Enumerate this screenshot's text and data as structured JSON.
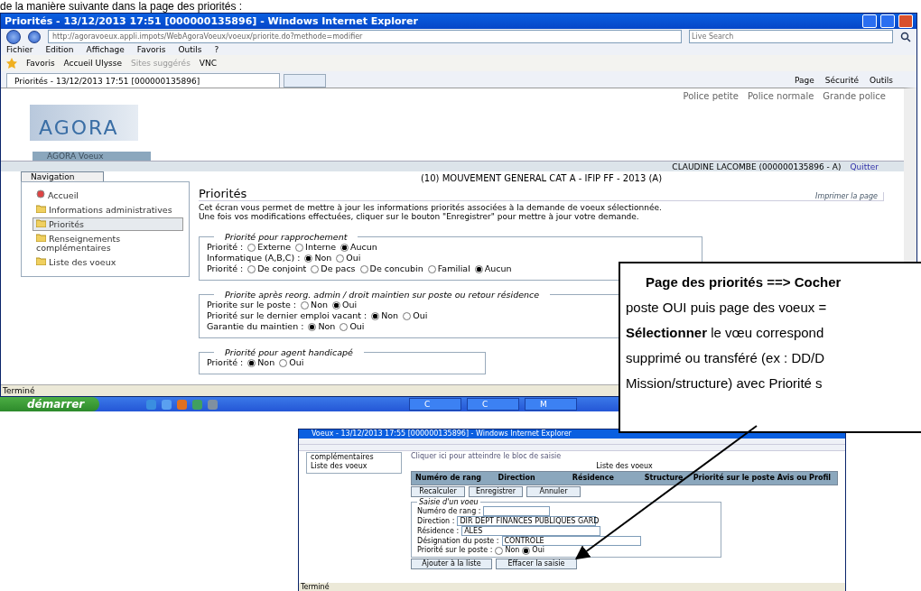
{
  "document_text": "de la manière suivante dans la page des priorités :",
  "browser": {
    "title": "Priorités - 13/12/2013 17:51 [000000135896] - Windows Internet Explorer",
    "address": "http://agoravoeux.appli.impots/WebAgoraVoeux/voeux/priorite.do?methode=modifier",
    "search_placeholder": "Live Search",
    "menu": [
      "Fichier",
      "Edition",
      "Affichage",
      "Favoris",
      "Outils",
      "?"
    ],
    "favorites": [
      {
        "label": "Favoris",
        "disabled": false
      },
      {
        "label": "Accueil Ulysse",
        "disabled": false
      },
      {
        "label": "Sites suggérés",
        "disabled": true
      },
      {
        "label": "VNC",
        "disabled": false
      }
    ],
    "tab": "Priorités - 13/12/2013 17:51 [000000135896]",
    "commands": [
      "Page",
      "Sécurité",
      "Outils"
    ],
    "status": "Terminé"
  },
  "page": {
    "font_links": [
      "Police petite",
      "Police normale",
      "Grande police"
    ],
    "logo": "AGORA",
    "app_tab": "AGORA Voeux",
    "user": "CLAUDINE LACOMBE (000000135896 - A)",
    "quit": "Quitter",
    "navigation": {
      "title": "Navigation",
      "items": [
        {
          "label": "Accueil",
          "kind": "home",
          "selected": false
        },
        {
          "label": "Informations administratives",
          "kind": "folder",
          "selected": false
        },
        {
          "label": "Priorités",
          "kind": "folder",
          "selected": true
        },
        {
          "label": "Renseignements complémentaires",
          "kind": "folder",
          "selected": false
        },
        {
          "label": "Liste des voeux",
          "kind": "folder",
          "selected": false
        }
      ]
    },
    "campaign": "(10) MOUVEMENT GENERAL CAT A - IFIP FF - 2013 (A)",
    "heading": "Priorités",
    "print": "Imprimer la page",
    "intro": [
      "Cet écran vous permet de mettre à jour les informations priorités associées à la demande de voeux sélectionnée.",
      "Une fois vos modifications effectuées, cliquer sur le bouton \"Enregistrer\" pour mettre à jour votre demande."
    ],
    "sections": [
      {
        "legend": "Priorité pour rapprochement",
        "rows": [
          {
            "label": "Priorité :",
            "options": [
              {
                "label": "Externe",
                "selected": false
              },
              {
                "label": "Interne",
                "selected": false
              },
              {
                "label": "Aucun",
                "selected": true
              }
            ]
          },
          {
            "label": "Informatique (A,B,C) :",
            "options": [
              {
                "label": "Non",
                "selected": true
              },
              {
                "label": "Oui",
                "selected": false
              }
            ]
          },
          {
            "label": "Priorité :",
            "options": [
              {
                "label": "De conjoint",
                "selected": false
              },
              {
                "label": "De pacs",
                "selected": false
              },
              {
                "label": "De concubin",
                "selected": false
              },
              {
                "label": "Familial",
                "selected": false
              },
              {
                "label": "Aucun",
                "selected": true
              }
            ]
          }
        ]
      },
      {
        "legend": "Priorite après reorg. admin / droit maintien sur poste ou retour résidence",
        "rows": [
          {
            "label": "Priorite sur le poste :",
            "options": [
              {
                "label": "Non",
                "selected": false
              },
              {
                "label": "Oui",
                "selected": true
              }
            ]
          },
          {
            "label": "Priorité sur le dernier emploi vacant :",
            "options": [
              {
                "label": "Non",
                "selected": true
              },
              {
                "label": "Oui",
                "selected": false
              }
            ]
          },
          {
            "label": "Garantie du maintien :",
            "options": [
              {
                "label": "Non",
                "selected": true
              },
              {
                "label": "Oui",
                "selected": false
              }
            ]
          }
        ]
      },
      {
        "legend": "Priorité pour agent handicapé",
        "rows": [
          {
            "label": "Priorité :",
            "options": [
              {
                "label": "Non",
                "selected": true
              },
              {
                "label": "Oui",
                "selected": false
              }
            ]
          }
        ]
      }
    ]
  },
  "taskbar": {
    "start": "démarrer",
    "tasks": [
      "C",
      "C",
      "M"
    ]
  },
  "callout": {
    "lines": [
      "Page des priorités ==> Cocher",
      "poste OUI puis page des voeux =",
      "**Sélectionner** le vœu correspond",
      "supprimé ou transféré (ex : DD/D",
      "Mission/structure) avec Priorité s"
    ]
  },
  "inset": {
    "title": "Voeux - 13/12/2013 17:55 [000000135896] - Windows Internet Explorer",
    "nav": [
      "complémentaires",
      "Liste des voeux"
    ],
    "link": "Cliquer ici pour atteindre le bloc de saisie",
    "table_title": "Liste des voeux",
    "columns": [
      "Numéro de rang",
      "Direction",
      "Résidence",
      "Structure",
      "Priorité sur le poste",
      "Avis ou Profil"
    ],
    "buttons": [
      "Recalculer",
      "Enregistrer",
      "Annuler"
    ],
    "legend": "Saisie d'un voeu",
    "fields": [
      {
        "label": "Numéro de rang :",
        "kind": "text"
      },
      {
        "label": "Direction :",
        "value": "DIR DEPT FINANCES PUBLIQUES GARD",
        "kind": "select"
      },
      {
        "label": "Résidence :",
        "value": "ALES",
        "kind": "select"
      },
      {
        "label": "Désignation du poste :",
        "value": "CONTROLE",
        "kind": "select"
      }
    ],
    "priority": {
      "label": "Priorité sur le poste :",
      "options": [
        {
          "label": "Non",
          "selected": false
        },
        {
          "label": "Oui",
          "selected": true
        }
      ]
    },
    "actions": [
      "Ajouter à la liste",
      "Effacer la saisie"
    ],
    "status": "Terminé"
  }
}
